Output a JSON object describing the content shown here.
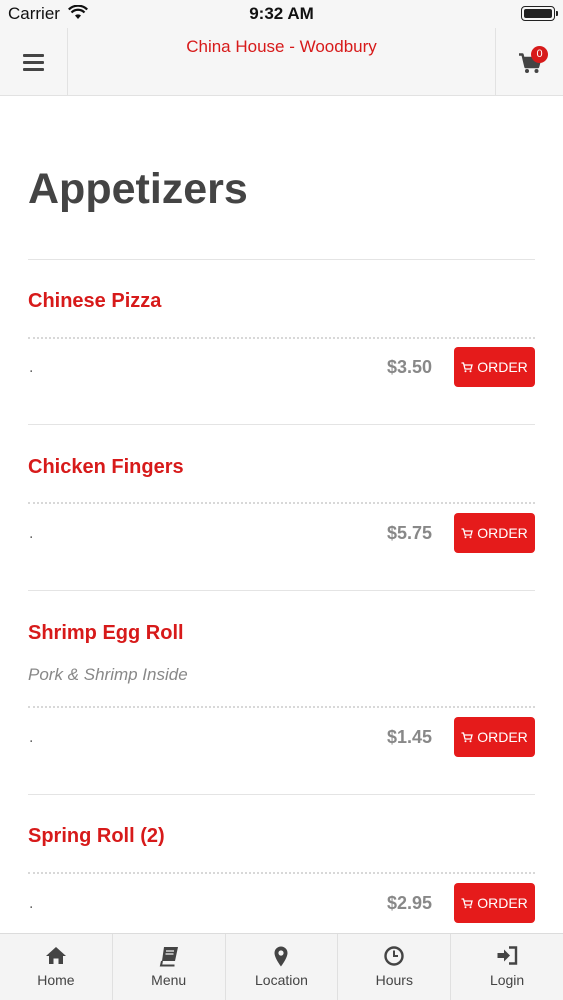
{
  "status_bar": {
    "carrier": "Carrier",
    "time": "9:32 AM"
  },
  "header": {
    "title": "China House - Woodbury",
    "cart_count": "0"
  },
  "page_title": "Appetizers",
  "order_label": "ORDER",
  "items": [
    {
      "name": "Chinese Pizza",
      "description": "",
      "dot": ".",
      "price": "$3.50"
    },
    {
      "name": "Chicken Fingers",
      "description": "",
      "dot": ".",
      "price": "$5.75"
    },
    {
      "name": "Shrimp Egg Roll",
      "description": "Pork & Shrimp Inside",
      "dot": ".",
      "price": "$1.45"
    },
    {
      "name": "Spring Roll (2)",
      "description": "",
      "dot": ".",
      "price": "$2.95"
    }
  ],
  "tabs": [
    {
      "label": "Home",
      "icon": "home-icon"
    },
    {
      "label": "Menu",
      "icon": "book-icon"
    },
    {
      "label": "Location",
      "icon": "map-pin-icon"
    },
    {
      "label": "Hours",
      "icon": "clock-icon"
    },
    {
      "label": "Login",
      "icon": "login-icon"
    }
  ],
  "colors": {
    "accent": "#d71a1a",
    "button": "#e51b1b",
    "heading": "#444444"
  }
}
